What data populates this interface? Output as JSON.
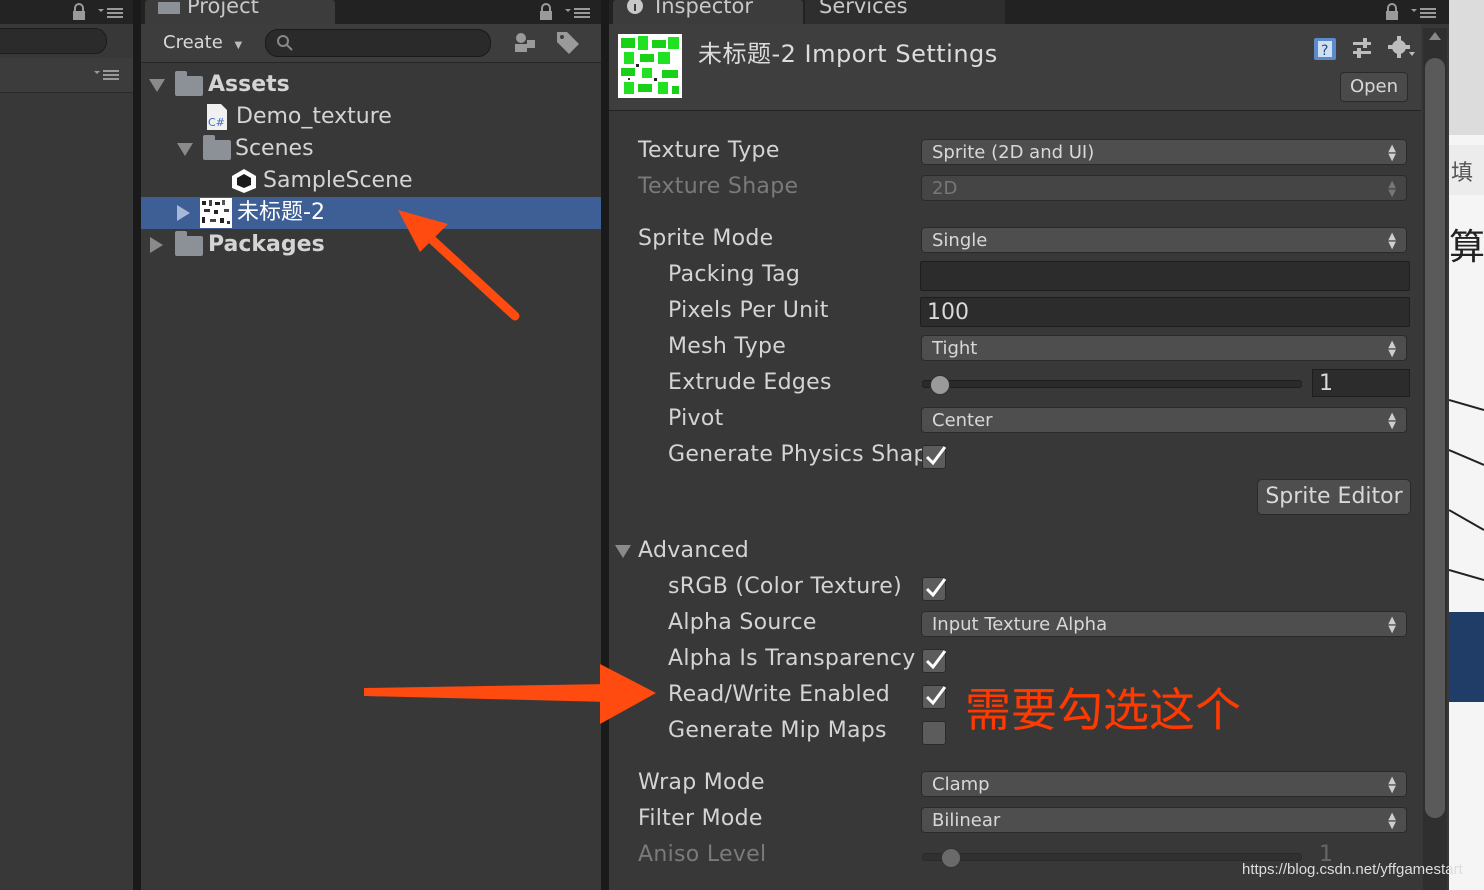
{
  "project": {
    "tab_label": "Project",
    "create_label": "Create",
    "tree": [
      {
        "label": "Assets",
        "type": "folder"
      },
      {
        "label": "Demo_texture",
        "type": "script"
      },
      {
        "label": "Scenes",
        "type": "folder"
      },
      {
        "label": "SampleScene",
        "type": "scene"
      },
      {
        "label": "未标题-2",
        "type": "texture",
        "selected": true
      },
      {
        "label": "Packages",
        "type": "folder"
      }
    ]
  },
  "inspector": {
    "tab_label": "Inspector",
    "services_label": "Services",
    "title": "未标题-2 Import Settings",
    "open_label": "Open",
    "texture_type_label": "Texture Type",
    "texture_type_value": "Sprite (2D and UI)",
    "texture_shape_label": "Texture Shape",
    "texture_shape_value": "2D",
    "sprite_mode_label": "Sprite Mode",
    "sprite_mode_value": "Single",
    "packing_tag_label": "Packing Tag",
    "packing_tag_value": "",
    "pixels_per_unit_label": "Pixels Per Unit",
    "pixels_per_unit_value": "100",
    "mesh_type_label": "Mesh Type",
    "mesh_type_value": "Tight",
    "extrude_edges_label": "Extrude Edges",
    "extrude_edges_value": "1",
    "pivot_label": "Pivot",
    "pivot_value": "Center",
    "generate_physics_shape_label": "Generate Physics Shape",
    "sprite_editor_label": "Sprite Editor",
    "advanced_label": "Advanced",
    "srgb_label": "sRGB (Color Texture)",
    "alpha_source_label": "Alpha Source",
    "alpha_source_value": "Input Texture Alpha",
    "alpha_is_transparency_label": "Alpha Is Transparency",
    "read_write_label": "Read/Write Enabled",
    "generate_mip_maps_label": "Generate Mip Maps",
    "wrap_mode_label": "Wrap Mode",
    "wrap_mode_value": "Clamp",
    "filter_mode_label": "Filter Mode",
    "filter_mode_value": "Bilinear",
    "aniso_level_label": "Aniso Level",
    "aniso_level_value": "1"
  },
  "annotation": {
    "text": "需要勾选这个",
    "color": "#ff3a00"
  },
  "right_strip": {
    "text_top": "填",
    "text_mid": "算"
  },
  "watermark": "https://blog.csdn.net/yffgamestart",
  "colors": {
    "selection": "#3e5f96",
    "arrow": "#ff4a10",
    "panel": "#383838"
  }
}
